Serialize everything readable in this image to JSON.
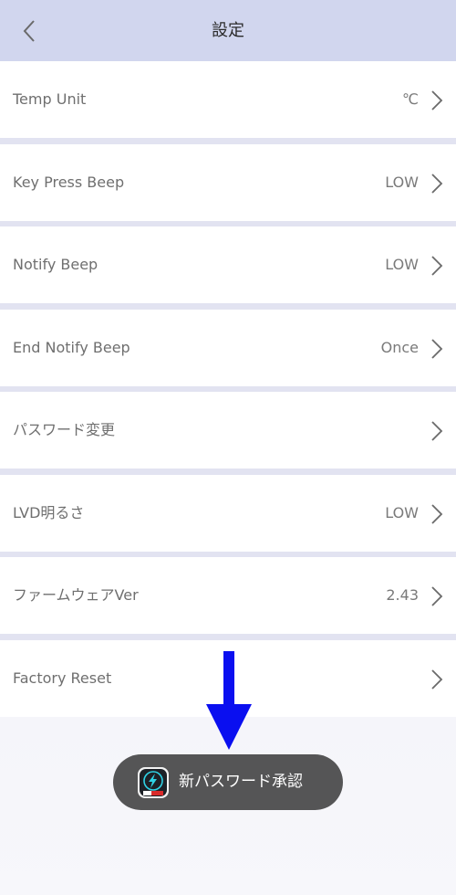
{
  "header": {
    "title": "設定",
    "back_icon": "chevron-left-icon"
  },
  "settings": [
    {
      "label": "Temp Unit",
      "value": "℃"
    },
    {
      "label": "Key Press Beep",
      "value": "LOW"
    },
    {
      "label": "Notify Beep",
      "value": "LOW"
    },
    {
      "label": "End Notify Beep",
      "value": "Once"
    },
    {
      "label": "パスワード変更",
      "value": ""
    },
    {
      "label": "LVD明るさ",
      "value": "LOW"
    },
    {
      "label": "ファームウェアVer",
      "value": "2.43"
    },
    {
      "label": "Factory Reset",
      "value": ""
    }
  ],
  "toast": {
    "text": "新パスワード承認",
    "icon": "app-lightning-icon"
  },
  "annotation": {
    "icon": "down-arrow-icon",
    "color": "#0a0ff0"
  },
  "colors": {
    "header_bg": "#d1d6ee",
    "separator": "#e2e3f1",
    "toast_bg": "#555556"
  }
}
